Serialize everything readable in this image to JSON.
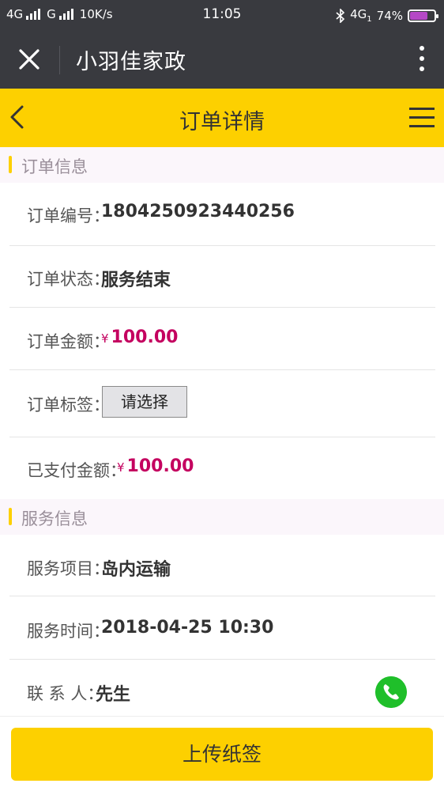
{
  "status_bar": {
    "network_1": "4G",
    "network_2": "G",
    "speed": "10K/s",
    "time": "11:05",
    "network_3": "4G",
    "network_3_sub": "1",
    "battery": "74%",
    "battery_level": 0.74,
    "battery_color": "#b548c6"
  },
  "wechat_bar": {
    "title": "小羽佳家政"
  },
  "header": {
    "title": "订单详情",
    "accent": "#fdd000"
  },
  "order_section": {
    "title": "订单信息",
    "order_no": {
      "label": "订单编号：",
      "value": "1804250923440256"
    },
    "status": {
      "label": "订单状态：",
      "value": "服务结束"
    },
    "amount": {
      "label": "订单金额：",
      "currency": "¥",
      "value": "100.00"
    },
    "tag": {
      "label": "订单标签：",
      "select_text": "请选择"
    },
    "paid": {
      "label": "已支付金额：",
      "currency": "¥",
      "value": "100.00"
    }
  },
  "service_section": {
    "title": "服务信息",
    "item": {
      "label": "服务项目：",
      "value": "岛内运输"
    },
    "time": {
      "label": "服务时间：",
      "value": "2018-04-25 10:30"
    },
    "contact": {
      "label": "联 系 人：",
      "value": "先生"
    }
  },
  "footer": {
    "upload_label": "上传纸签"
  },
  "icons": [
    "close-icon",
    "more-vertical-icon",
    "back-icon",
    "menu-icon",
    "phone-icon",
    "bluetooth-icon",
    "signal-icon",
    "battery-icon"
  ]
}
